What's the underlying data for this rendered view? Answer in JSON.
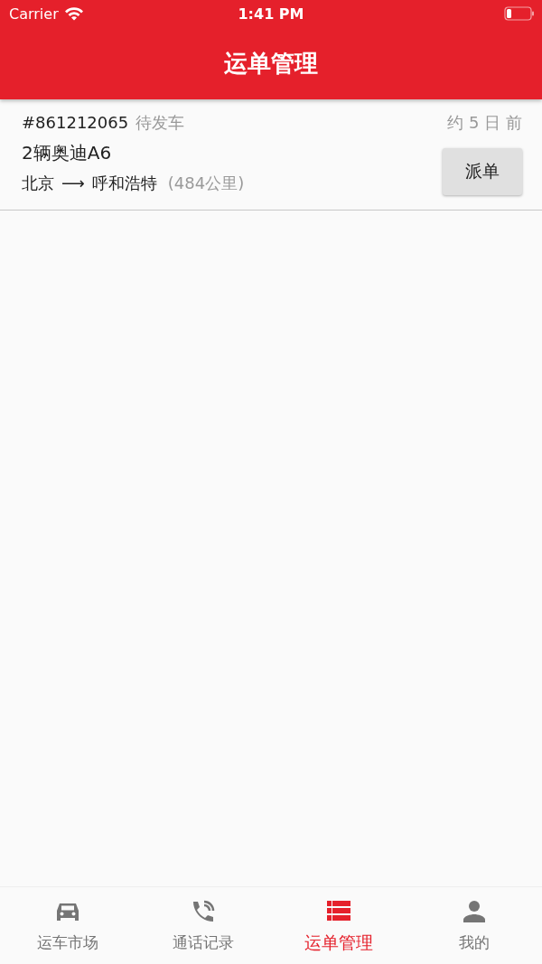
{
  "status_bar": {
    "carrier": "Carrier",
    "time": "1:41 PM"
  },
  "header": {
    "title": "运单管理"
  },
  "orders": [
    {
      "number": "#861212065",
      "status": "待发车",
      "time": "约 5 日 前",
      "vehicle": "2辆奥迪A6",
      "origin": "北京",
      "arrow": "⟶",
      "destination": "呼和浩特",
      "distance": "(484公里)",
      "action": "派单"
    }
  ],
  "tabs": [
    {
      "label": "运车市场",
      "selected": false
    },
    {
      "label": "通话记录",
      "selected": false
    },
    {
      "label": "运单管理",
      "selected": true
    },
    {
      "label": "我的",
      "selected": false
    }
  ]
}
